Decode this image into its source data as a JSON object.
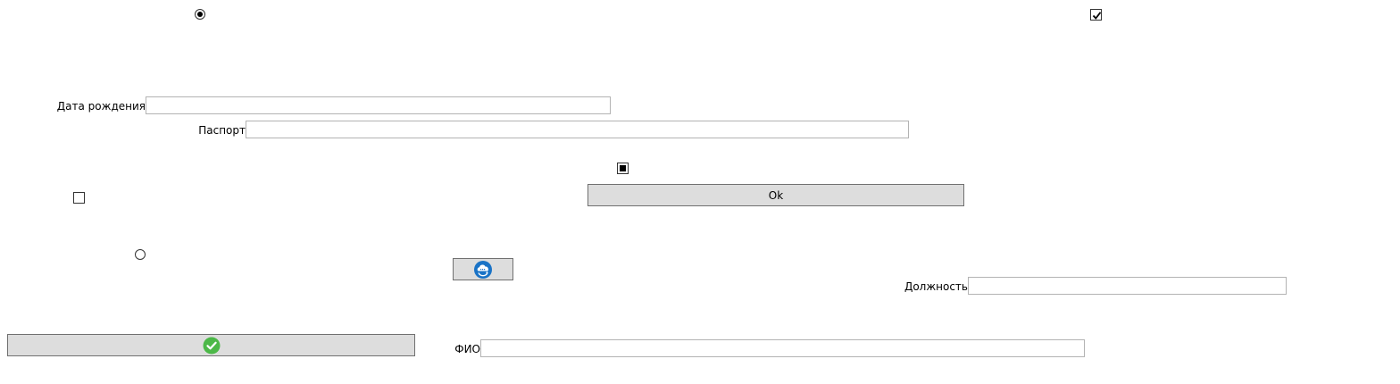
{
  "form": {
    "birth_date": {
      "label": "Дата рождения",
      "value": ""
    },
    "passport": {
      "label": "Паспорт",
      "value": ""
    },
    "position": {
      "label": "Должность",
      "value": ""
    },
    "full_name": {
      "label": "ФИО",
      "value": ""
    }
  },
  "buttons": {
    "ok_label": "Ok",
    "refresh_icon": "cloud-refresh-icon",
    "confirm_icon": "green-checkmark-icon"
  },
  "controls": {
    "radio_top": {
      "checked": true
    },
    "radio_bottom": {
      "checked": false
    },
    "checkbox_top_right": {
      "state": "checked"
    },
    "checkbox_middle": {
      "state": "indeterminate"
    },
    "checkbox_left": {
      "state": "unchecked"
    }
  },
  "colors": {
    "button_bg": "#dddddd",
    "button_border": "#707070",
    "field_border": "#b3b3b3",
    "refresh_icon_blue": "#1a73c6",
    "confirm_icon_green": "#4cb848"
  }
}
